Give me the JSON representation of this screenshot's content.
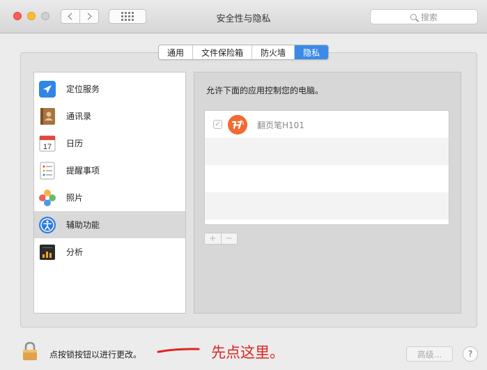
{
  "window": {
    "title": "安全性与隐私"
  },
  "search": {
    "placeholder": "搜索"
  },
  "tabs": [
    {
      "label": "通用",
      "active": false
    },
    {
      "label": "文件保险箱",
      "active": false
    },
    {
      "label": "防火墙",
      "active": false
    },
    {
      "label": "隐私",
      "active": true
    }
  ],
  "sidebar": {
    "items": [
      {
        "label": "定位服务",
        "icon": "location-arrow-icon",
        "selected": false
      },
      {
        "label": "通讯录",
        "icon": "contacts-book-icon",
        "selected": false
      },
      {
        "label": "日历",
        "icon": "calendar-icon",
        "date": "17",
        "selected": false
      },
      {
        "label": "提醒事项",
        "icon": "reminders-icon",
        "selected": false
      },
      {
        "label": "照片",
        "icon": "photos-flower-icon",
        "selected": false
      },
      {
        "label": "辅助功能",
        "icon": "accessibility-icon",
        "selected": true
      },
      {
        "label": "分析",
        "icon": "analytics-chart-icon",
        "selected": false
      }
    ]
  },
  "content": {
    "description": "允许下面的应用控制您的电脑。",
    "apps": [
      {
        "name": "翻页笔H101",
        "checked": true,
        "icon": "presenter-app-icon"
      }
    ],
    "add_label": "+",
    "remove_label": "−"
  },
  "footer": {
    "lock_text": "点按锁按钮以进行更改。",
    "annotation": "先点这里。",
    "advanced_label": "高级...",
    "help_label": "?"
  },
  "colors": {
    "accent": "#3b8ae8",
    "annotation": "#e0241e",
    "selected_row": "#d9d9d9"
  }
}
